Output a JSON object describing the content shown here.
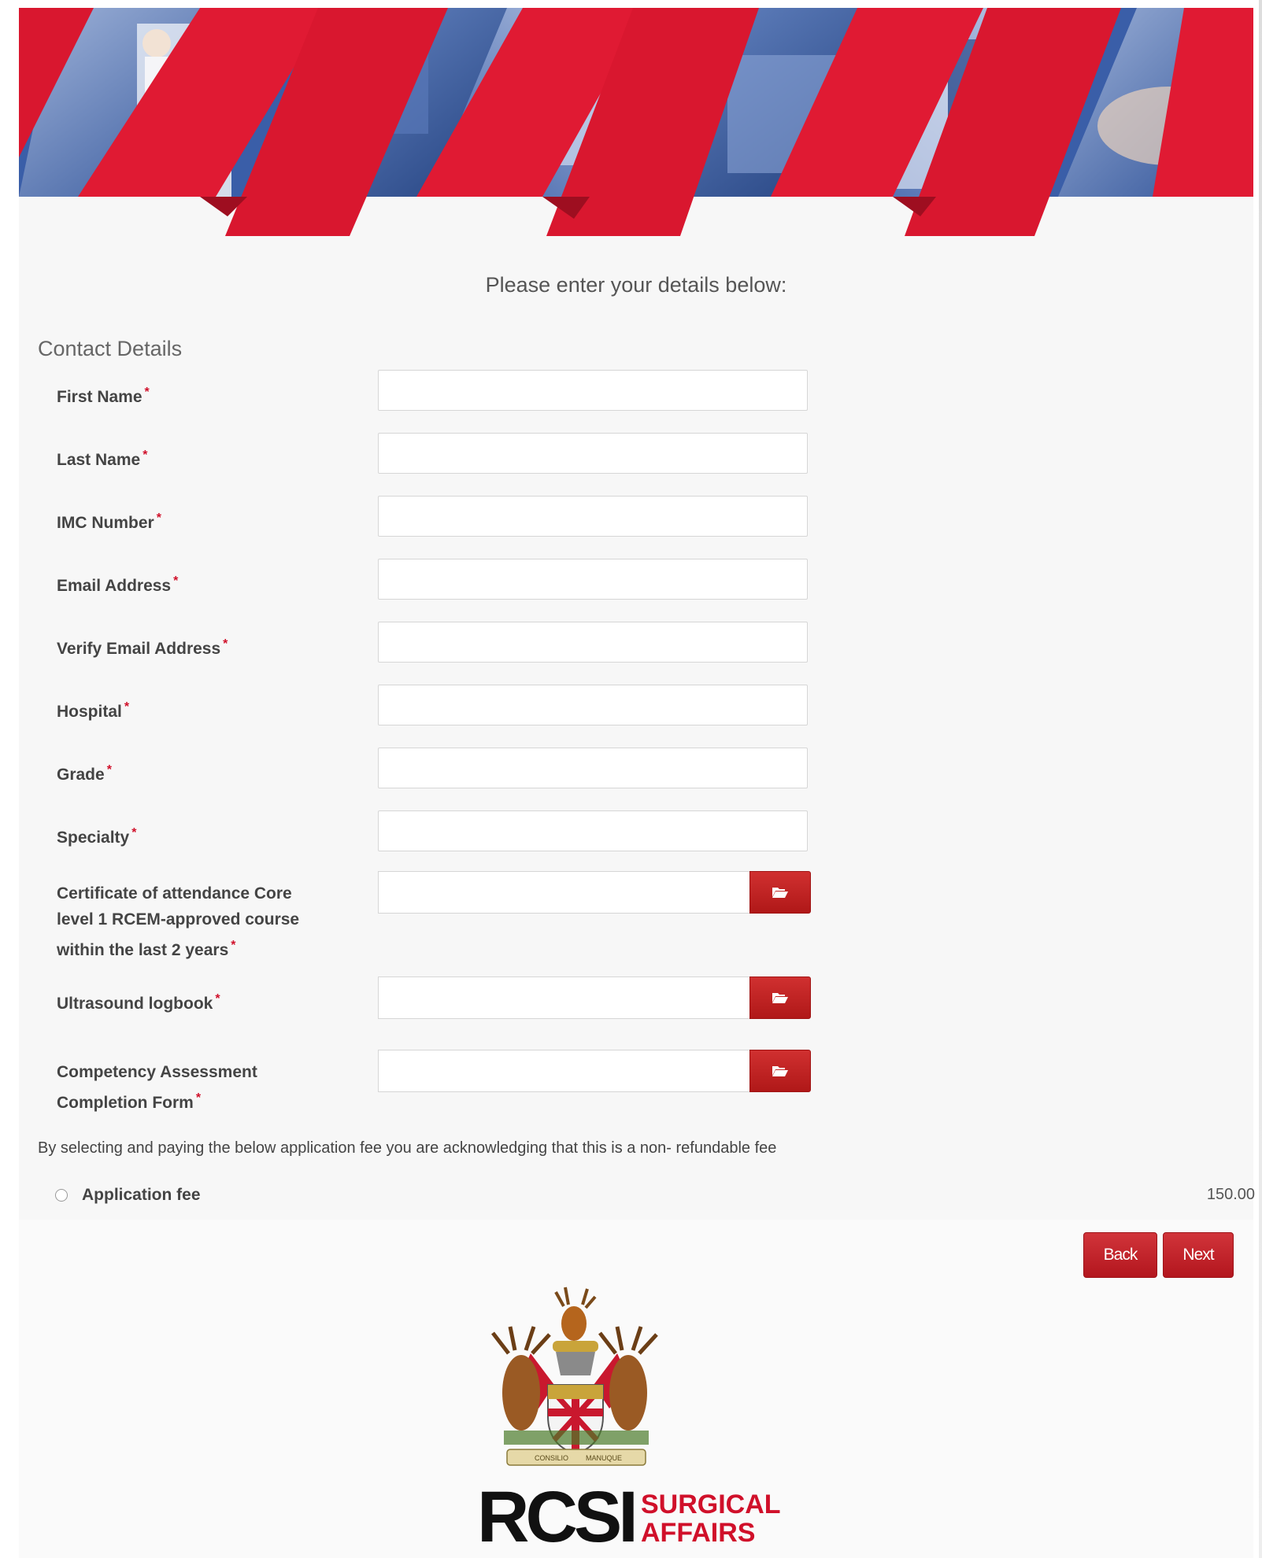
{
  "intro_text": "Please enter your details below:",
  "section_title": "Contact Details",
  "required_mark": "*",
  "fields": [
    {
      "label": "First Name",
      "value": ""
    },
    {
      "label": "Last Name",
      "value": ""
    },
    {
      "label": "IMC Number",
      "value": ""
    },
    {
      "label": "Email Address",
      "value": ""
    },
    {
      "label": "Verify Email Address",
      "value": ""
    },
    {
      "label": "Hospital",
      "value": ""
    },
    {
      "label": "Grade",
      "value": ""
    },
    {
      "label": "Specialty",
      "value": ""
    }
  ],
  "file_fields": [
    {
      "label": "Certificate of attendance Core level 1 RCEM-approved course within the last 2 years",
      "value": ""
    },
    {
      "label": "Ultrasound logbook",
      "value": ""
    },
    {
      "label": "Competency Assessment Completion Form",
      "value": ""
    }
  ],
  "fee": {
    "note": "By selecting and paying the below application fee you are acknowledging that this is a non- refundable fee",
    "label": "Application fee",
    "amount": "150.00",
    "selected": false
  },
  "buttons": {
    "back": "Back",
    "next": "Next"
  },
  "logo": {
    "main": "RCSI",
    "sub_line1": "SURGICAL",
    "sub_line2": "AFFAIRS",
    "crest_motto_left": "CONSILIO",
    "crest_motto_right": "MANUQUE"
  },
  "colors": {
    "brand_red": "#d0102a",
    "button_red": "#b3161e",
    "banner_blue": "#3a5ea8"
  },
  "icons": {
    "file_browse": "folder-open-icon"
  }
}
